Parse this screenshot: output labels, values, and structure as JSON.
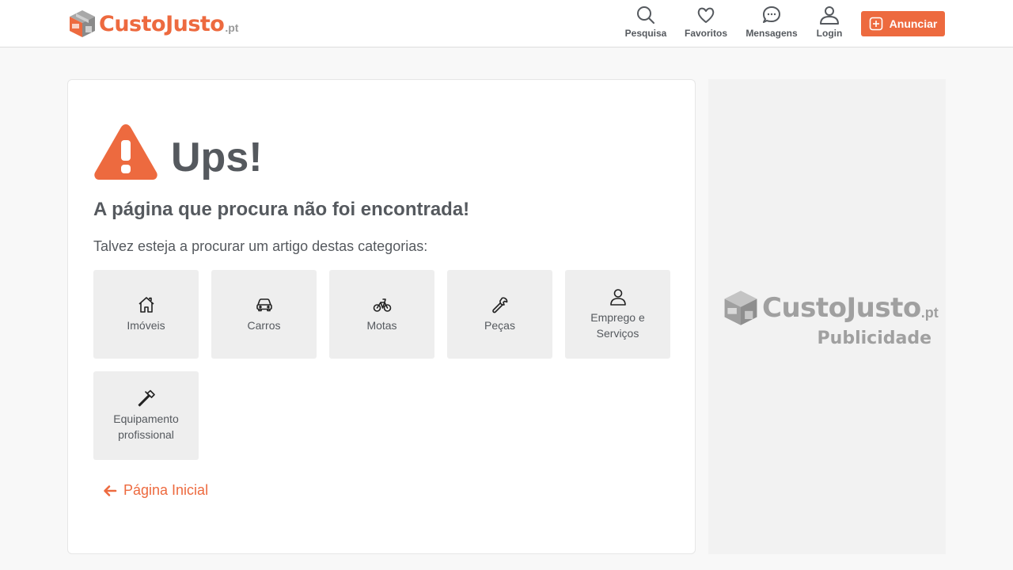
{
  "brand": {
    "name": "CustoJusto",
    "tld": ".pt",
    "accent": "#ed6a3f"
  },
  "nav": {
    "items": [
      {
        "label": "Pesquisa",
        "icon": "search-icon"
      },
      {
        "label": "Favoritos",
        "icon": "heart-icon"
      },
      {
        "label": "Mensagens",
        "icon": "chat-icon"
      },
      {
        "label": "Login",
        "icon": "user-icon"
      }
    ],
    "cta_label": "Anunciar",
    "cta_icon": "plus-square-icon"
  },
  "error": {
    "title": "Ups!",
    "subtitle": "A página que procura não foi encontrada!",
    "hint": "Talvez esteja a procurar um artigo destas categorias:",
    "icon": "warning-icon"
  },
  "categories": [
    {
      "label": "Imóveis",
      "icon": "house-icon"
    },
    {
      "label": "Carros",
      "icon": "car-icon"
    },
    {
      "label": "Motas",
      "icon": "bicycle-icon"
    },
    {
      "label": "Peças",
      "icon": "wrench-icon"
    },
    {
      "label": "Emprego e Serviços",
      "icon": "person-icon"
    },
    {
      "label": "Equipamento profissional",
      "icon": "hammer-icon"
    }
  ],
  "home_link": {
    "label": "Página Inicial",
    "icon": "arrow-left-icon"
  },
  "ad": {
    "brand": "CustoJusto",
    "tld": ".pt",
    "caption": "Publicidade"
  }
}
